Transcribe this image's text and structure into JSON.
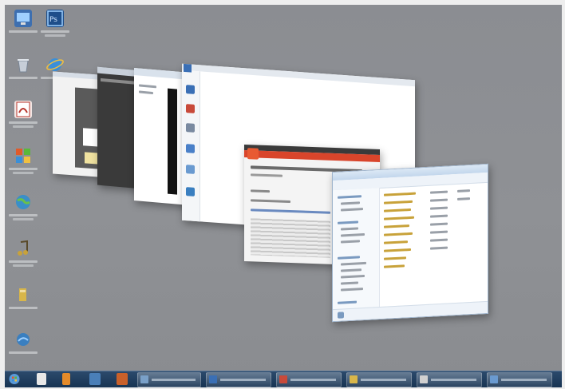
{
  "desktop": {
    "icons": [
      {
        "name": "computer-icon",
        "color": "#3d6fb0"
      },
      {
        "name": "photoshop-icon",
        "color": "#1e4e8a"
      },
      {
        "name": "recycle-bin-icon",
        "color": "#c7ced8"
      },
      {
        "name": "internet-explorer-icon",
        "color": "#3b8fd8"
      },
      {
        "name": "adobe-reader-icon",
        "color": "#b8362d"
      },
      {
        "name": "windows-media-icon",
        "color": "#3a6fb5"
      },
      {
        "name": "globe-icon",
        "color": "#3a8fc8"
      },
      {
        "name": "music-icon",
        "color": "#c8a23a"
      },
      {
        "name": "folder-icon",
        "color": "#d8b64a"
      },
      {
        "name": "network-icon",
        "color": "#3a7fc0"
      }
    ]
  },
  "flip3d": {
    "windows": [
      {
        "name": "window-back-1",
        "color": "#f2f2f2"
      },
      {
        "name": "window-back-2",
        "color": "#3a3a3a"
      },
      {
        "name": "window-back-3",
        "color": "#ffffff"
      },
      {
        "name": "window-back-4",
        "color": "#ffffff"
      },
      {
        "name": "window-browser",
        "color": "#f4f4f4",
        "accent": "#d9452b"
      },
      {
        "name": "window-explorer",
        "color": "#ffffff",
        "accent": "#cfe0f2"
      }
    ]
  },
  "taskbar": {
    "accent": "#183453",
    "buttons": [
      {
        "name": "taskbar-start-button",
        "color": "#5a9ad8"
      },
      {
        "name": "taskbar-explorer",
        "color": "#e8e8e8"
      },
      {
        "name": "taskbar-media",
        "color": "#e58b2a"
      },
      {
        "name": "taskbar-app-1",
        "color": "#4a7fb8"
      },
      {
        "name": "taskbar-app-2",
        "color": "#c8602a"
      },
      {
        "name": "taskbar-window-1",
        "color": "#7aa0c8"
      },
      {
        "name": "taskbar-window-2",
        "color": "#3a6fb5"
      },
      {
        "name": "taskbar-window-3",
        "color": "#c84a3a"
      },
      {
        "name": "taskbar-window-4",
        "color": "#d8b64a"
      },
      {
        "name": "taskbar-window-5",
        "color": "#d0d0d0"
      },
      {
        "name": "taskbar-window-6",
        "color": "#6a9ad0"
      }
    ]
  }
}
